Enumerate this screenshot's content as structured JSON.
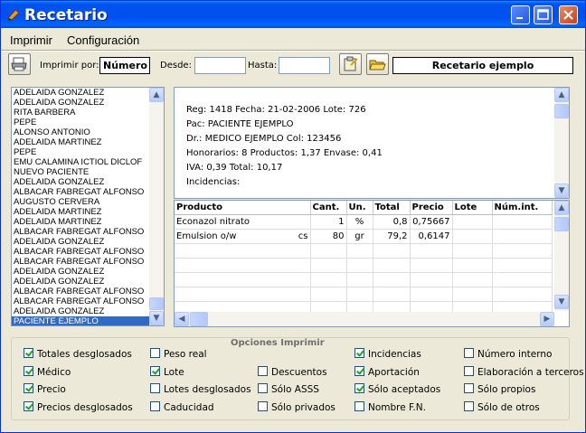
{
  "window": {
    "title": "Recetario",
    "colors": {
      "titlebar": "#0053ee",
      "face": "#ece9d8",
      "selection": "#316ac5",
      "check": "#21a121"
    }
  },
  "menu": {
    "items": [
      {
        "label": "Imprimir"
      },
      {
        "label": "Configuración"
      }
    ]
  },
  "toolbar": {
    "imprimir_por_label": "Imprimir por:",
    "imprimir_por_value": "Número",
    "desde_label": "Desde:",
    "desde_value": "",
    "hasta_label": "Hasta:",
    "hasta_value": "",
    "recetario_name": "Recetario ejemplo",
    "icons": [
      "printer-icon",
      "edit-document-icon",
      "open-folder-icon"
    ]
  },
  "patients": [
    "ADELAIDA GONZALEZ",
    "ADELAIDA GONZALEZ",
    "RITA BARBERA",
    "PEPE",
    "ALONSO ANTONIO",
    "ADELAIDA MARTINEZ",
    "PEPE",
    "EMU CALAMINA ICTIOL DICLOF",
    "NUEVO PACIENTE",
    "ADELAIDA GONZALEZ",
    "ALBACAR FABREGAT ALFONSO",
    "AUGUSTO CERVERA",
    "ADELAIDA MARTINEZ",
    "ADELAIDA MARTINEZ",
    "ALBACAR FABREGAT ALFONSO",
    "ADELAIDA GONZALEZ",
    "ALBACAR FABREGAT ALFONSO",
    "ALBACAR FABREGAT ALFONSO",
    "ADELAIDA GONZALEZ",
    "ADELAIDA GONZALEZ",
    "ALBACAR FABREGAT ALFONSO",
    "ALBACAR FABREGAT ALFONSO",
    "ADELAIDA GONZALEZ",
    "PACIENTE EJEMPLO"
  ],
  "selected_patient": "PACIENTE EJEMPLO",
  "detail": {
    "lines": [
      "Reg: 1418  Fecha: 21-02-2006  Lote: 726",
      "Pac: PACIENTE EJEMPLO",
      "Dr.: MEDICO EJEMPLO  Col: 123456",
      "Honorarios: 8  Productos: 1,37  Envase: 0,41",
      "IVA: 0,39  Total: 10,17",
      "Incidencias:"
    ]
  },
  "products": {
    "columns": [
      "Producto",
      "Cant.",
      "Un.",
      "Total",
      "Precio",
      "Lote",
      "Núm.int."
    ],
    "rows": [
      {
        "producto": "Econazol nitrato",
        "extra": "",
        "cant": "1",
        "un": "%",
        "total": "0,8",
        "precio": "0,75667",
        "lote": "",
        "numint": ""
      },
      {
        "producto": "Emulsion o/w",
        "extra": "cs",
        "cant": "80",
        "un": "gr",
        "total": "79,2",
        "precio": "0,6147",
        "lote": "",
        "numint": ""
      }
    ]
  },
  "options": {
    "title": "Opciones Imprimir",
    "checkboxes": [
      {
        "label": "Totales desglosados",
        "checked": true
      },
      {
        "label": "Médico",
        "checked": true
      },
      {
        "label": "Precio",
        "checked": true
      },
      {
        "label": "Precios desglosados",
        "checked": true
      },
      {
        "label": "Peso real",
        "checked": false
      },
      {
        "label": "Lote",
        "checked": true
      },
      {
        "label": "Lotes desglosados",
        "checked": false
      },
      {
        "label": "Caducidad",
        "checked": false
      },
      {
        "label": "Descuentos",
        "checked": false
      },
      {
        "label": "Sólo ASSS",
        "checked": false
      },
      {
        "label": "Sólo privados",
        "checked": false
      },
      {
        "label": "Incidencias",
        "checked": true
      },
      {
        "label": "Aportación",
        "checked": true
      },
      {
        "label": "Sólo aceptados",
        "checked": true
      },
      {
        "label": "Nombre F.N.",
        "checked": false
      },
      {
        "label": "Número interno",
        "checked": false
      },
      {
        "label": "Elaboración a terceros",
        "checked": false
      },
      {
        "label": "Sólo propios",
        "checked": false
      },
      {
        "label": "Sólo de otros",
        "checked": false
      }
    ]
  }
}
